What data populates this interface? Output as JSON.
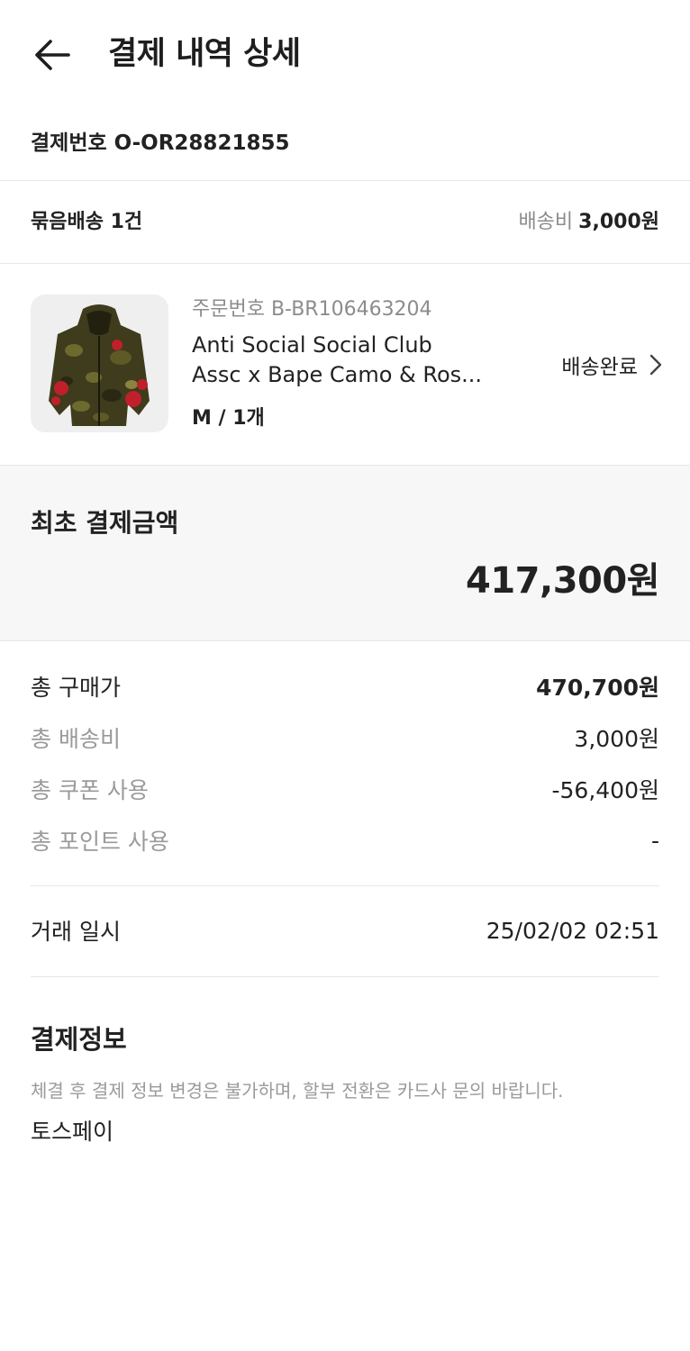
{
  "header": {
    "title": "결제 내역 상세",
    "back_icon": "arrow-left-icon"
  },
  "payment": {
    "number_label": "결제번호",
    "number_value": "O-OR28821855"
  },
  "bundle": {
    "label": "묶음배송 1건",
    "shipping_fee_label": "배송비",
    "shipping_fee_value": "3,000원"
  },
  "product": {
    "order_no": "주문번호 B-BR106463204",
    "name_line1": "Anti Social Social Club",
    "name_line2": "Assc x Bape Camo & Ros...",
    "option": "M / 1개",
    "status": "배송완료",
    "status_icon": "chevron-right-icon",
    "image_icon": "camo-hoodie-image"
  },
  "initial_payment": {
    "label": "최초 결제금액",
    "amount": "417,300원"
  },
  "details": [
    {
      "label": "총 구매가",
      "value": "470,700원"
    },
    {
      "label": "총 배송비",
      "value": "3,000원"
    },
    {
      "label": "총 쿠폰 사용",
      "value": "-56,400원"
    },
    {
      "label": "총 포인트 사용",
      "value": "-"
    }
  ],
  "transaction": {
    "label": "거래 일시",
    "value": "25/02/02 02:51"
  },
  "payment_info": {
    "title": "결제정보",
    "note": "체결 후 결제 정보 변경은 불가하며, 할부 전환은 카드사 문의 바랍니다.",
    "method": "토스페이"
  },
  "colors": {
    "text": "#222222",
    "muted": "#9a9a9a",
    "panel_bg": "#f7f7f7",
    "divider": "#e6e6e6"
  }
}
